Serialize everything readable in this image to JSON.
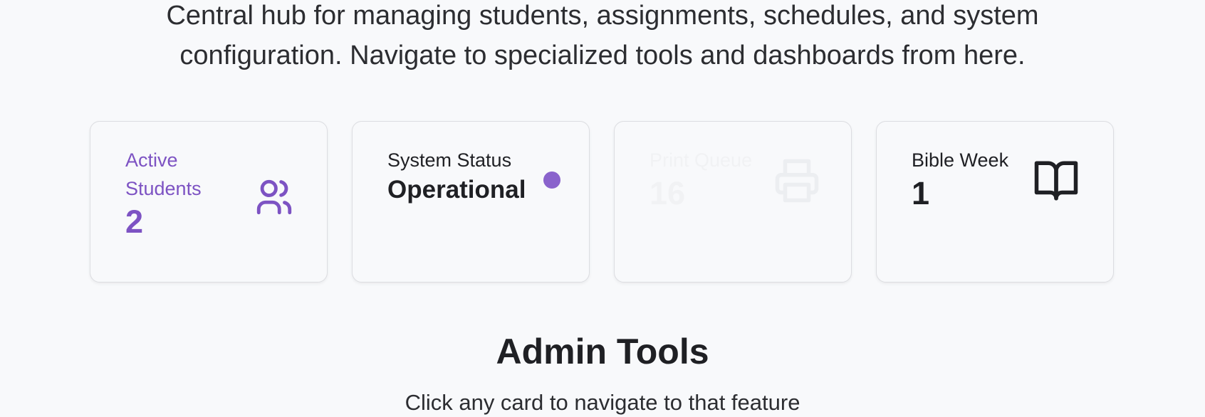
{
  "intro": {
    "line1": "Central hub for managing students, assignments, schedules, and system",
    "line2": "configuration. Navigate to specialized tools and dashboards from here."
  },
  "stats": {
    "active_students": {
      "label": "Active Students",
      "value": "2",
      "icon": "users-icon",
      "color": "#7d53c3"
    },
    "system_status": {
      "label": "System Status",
      "value": "Operational",
      "indicator_color": "#8a63cc"
    },
    "print_queue": {
      "label": "Print Queue",
      "value": "16",
      "icon": "printer-icon"
    },
    "bible_week": {
      "label": "Bible Week",
      "value": "1",
      "icon": "book-open-icon"
    }
  },
  "admin_tools": {
    "title": "Admin Tools",
    "subtitle": "Click any card to navigate to that feature"
  }
}
